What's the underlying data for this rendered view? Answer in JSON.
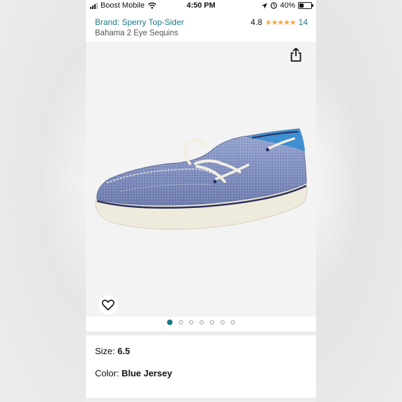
{
  "status_bar": {
    "carrier": "Boost Mobile",
    "time": "4:50 PM",
    "battery": "40%",
    "battery_level": 0.4
  },
  "product": {
    "brand": "Brand: Sperry Top-Sider",
    "name": "Bahama 2 Eye Sequins",
    "rating": "4.8",
    "stars": "★★★★★",
    "review_count": "14"
  },
  "gallery": {
    "image_count": 7,
    "active_index": 0
  },
  "options": {
    "size_label": "Size:",
    "size_value": "6.5",
    "color_label": "Color:",
    "color_value": "Blue Jersey"
  },
  "colors": {
    "accent": "#1a7a8a",
    "stars": "#f3a847",
    "shoe_upper": "#8898c4",
    "shoe_sole": "#eeeadc",
    "shoe_lining": "#3f8fd1"
  },
  "icons": [
    "signal-icon",
    "wifi-icon",
    "location-icon",
    "alarm-icon",
    "battery-icon",
    "share-icon",
    "heart-icon"
  ]
}
